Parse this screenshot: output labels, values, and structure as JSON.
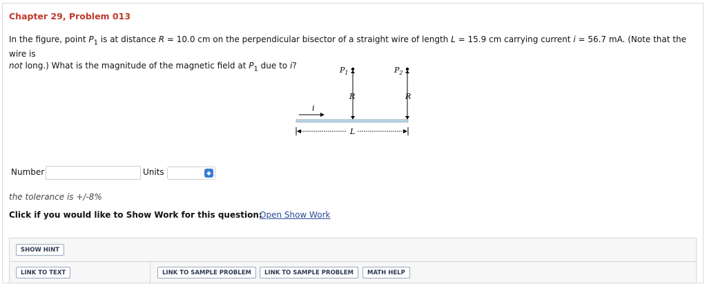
{
  "problem": {
    "title": "Chapter 29, Problem 013",
    "p1_before_p": "In the figure, point ",
    "p_sym": "P",
    "p_sub": "1",
    "p1_mid1": " is at distance ",
    "r_sym": "R",
    "p1_mid2": " = 10.0 cm on the perpendicular bisector of a straight wire of length ",
    "l_sym": "L",
    "p1_mid3": " = 15.9 cm carrying current ",
    "i_sym": "i",
    "p1_end": " = 56.7 mA. (Note that the wire is",
    "p2_not": "not",
    "p2_mid": " long.) What is the magnitude of the magnetic field at ",
    "p2_due": " due to ",
    "p2_end": "?"
  },
  "figure": {
    "p1_label": "P",
    "p1_sub": "1",
    "p2_label": "P",
    "p2_sub": "2",
    "r_label": "R",
    "l_label": "L",
    "i_label": "i"
  },
  "answer": {
    "number_label": "Number",
    "number_value": "",
    "units_label": "Units",
    "units_value": ""
  },
  "tolerance": "the tolerance is +/-8%",
  "show_work": {
    "question": "Click if you would like to Show Work for this question:",
    "link": "Open Show Work"
  },
  "buttons": {
    "show_hint": "SHOW HINT",
    "link_to_text": "LINK TO TEXT",
    "sample1": "LINK TO SAMPLE PROBLEM",
    "sample2": "LINK TO SAMPLE PROBLEM",
    "math_help": "MATH HELP"
  }
}
